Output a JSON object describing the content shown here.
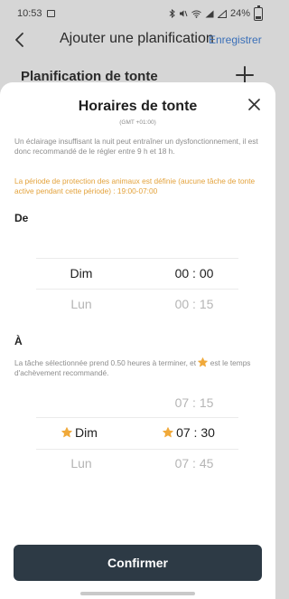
{
  "status_bar": {
    "time": "10:53",
    "battery": "24%"
  },
  "background_page": {
    "title": "Ajouter une planification",
    "save_label": "Enregistrer",
    "section_title": "Planification de tonte"
  },
  "sheet": {
    "title": "Horaires de tonte",
    "timezone": "(GMT +01:00)",
    "warning": "Un éclairage insuffisant la nuit peut entraîner un dysfonctionnement, il est donc recommandé de le régler entre 9 h et 18 h.",
    "protection_note": "La période de protection des animaux est définie (aucune tâche de tonte active pendant cette période) : 19:00-07:00",
    "from_label": "De",
    "from_picker": {
      "day_selected": "Dim",
      "day_next": "Lun",
      "time_selected": "00 : 00",
      "time_next": "00 : 15"
    },
    "to_label": "À",
    "duration_note_before": "La tâche sélectionnée prend 0.50 heures à terminer, et ",
    "duration_note_after": " est le temps d'achèvement recommandé.",
    "to_picker": {
      "time_prev": "07 : 15",
      "day_selected": "Dim",
      "time_selected": "07 : 30",
      "day_next": "Lun",
      "time_next": "07 : 45"
    },
    "confirm_label": "Confirmer"
  },
  "colors": {
    "accent_orange": "#e3a23b",
    "confirm_button": "#2d3a45",
    "link_blue": "#3a6fb8"
  },
  "icons": {
    "back": "chevron-left-icon",
    "close": "close-icon",
    "add": "plus-icon",
    "recommended": "star-icon"
  }
}
